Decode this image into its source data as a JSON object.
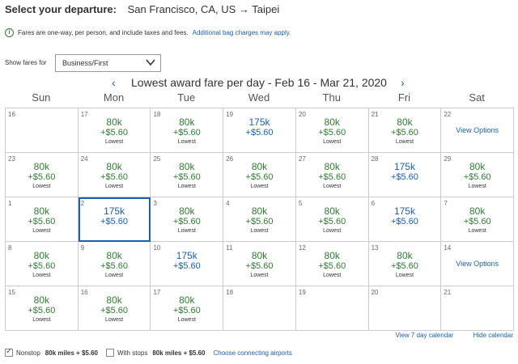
{
  "header": {
    "label": "Select your departure:",
    "route": "San Francisco, CA, US → Taipei"
  },
  "info": {
    "text": "Fares are one-way, per person, and include taxes and fees.",
    "link": "Additional bag charges may apply."
  },
  "filter": {
    "label": "Show fares for",
    "value": "Business/First"
  },
  "calendar": {
    "title": "Lowest award fare per day - Feb 16 - Mar 21, 2020",
    "days": [
      "Sun",
      "Mon",
      "Tue",
      "Wed",
      "Thu",
      "Fri",
      "Sat"
    ],
    "weeks": [
      [
        {
          "num": "16"
        },
        {
          "num": "17",
          "price": "80k",
          "fee": "+$5.60",
          "note": "Lowest",
          "color": "green"
        },
        {
          "num": "18",
          "price": "80k",
          "fee": "+$5.60",
          "note": "Lowest",
          "color": "green"
        },
        {
          "num": "19",
          "price": "175k",
          "fee": "+$5.60",
          "color": "blue"
        },
        {
          "num": "20",
          "price": "80k",
          "fee": "+$5.60",
          "note": "Lowest",
          "color": "green"
        },
        {
          "num": "21",
          "price": "80k",
          "fee": "+$5.60",
          "note": "Lowest",
          "color": "green"
        },
        {
          "num": "22",
          "link": "View Options"
        }
      ],
      [
        {
          "num": "23",
          "price": "80k",
          "fee": "+$5.60",
          "note": "Lowest",
          "color": "green"
        },
        {
          "num": "24",
          "price": "80k",
          "fee": "+$5.60",
          "note": "Lowest",
          "color": "green"
        },
        {
          "num": "25",
          "price": "80k",
          "fee": "+$5.60",
          "note": "Lowest",
          "color": "green"
        },
        {
          "num": "26",
          "price": "80k",
          "fee": "+$5.60",
          "note": "Lowest",
          "color": "green"
        },
        {
          "num": "27",
          "price": "80k",
          "fee": "+$5.60",
          "note": "Lowest",
          "color": "green"
        },
        {
          "num": "28",
          "price": "175k",
          "fee": "+$5.60",
          "color": "blue"
        },
        {
          "num": "29",
          "price": "80k",
          "fee": "+$5.60",
          "note": "Lowest",
          "color": "green"
        }
      ],
      [
        {
          "num": "1",
          "price": "80k",
          "fee": "+$5.60",
          "note": "Lowest",
          "color": "green"
        },
        {
          "num": "2",
          "price": "175k",
          "fee": "+$5.60",
          "color": "blue",
          "selected": true
        },
        {
          "num": "3",
          "price": "80k",
          "fee": "+$5.60",
          "note": "Lowest",
          "color": "green"
        },
        {
          "num": "4",
          "price": "80k",
          "fee": "+$5.60",
          "note": "Lowest",
          "color": "green"
        },
        {
          "num": "5",
          "price": "80k",
          "fee": "+$5.60",
          "note": "Lowest",
          "color": "green"
        },
        {
          "num": "6",
          "price": "175k",
          "fee": "+$5.60",
          "color": "blue"
        },
        {
          "num": "7",
          "price": "80k",
          "fee": "+$5.60",
          "note": "Lowest",
          "color": "green"
        }
      ],
      [
        {
          "num": "8",
          "price": "80k",
          "fee": "+$5.60",
          "note": "Lowest",
          "color": "green"
        },
        {
          "num": "9",
          "price": "80k",
          "fee": "+$5.60",
          "note": "Lowest",
          "color": "green"
        },
        {
          "num": "10",
          "price": "175k",
          "fee": "+$5.60",
          "color": "blue"
        },
        {
          "num": "11",
          "price": "80k",
          "fee": "+$5.60",
          "note": "Lowest",
          "color": "green"
        },
        {
          "num": "12",
          "price": "80k",
          "fee": "+$5.60",
          "note": "Lowest",
          "color": "green"
        },
        {
          "num": "13",
          "price": "80k",
          "fee": "+$5.60",
          "note": "Lowest",
          "color": "green"
        },
        {
          "num": "14",
          "link": "View Options"
        }
      ],
      [
        {
          "num": "15",
          "price": "80k",
          "fee": "+$5.60",
          "note": "Lowest",
          "color": "green"
        },
        {
          "num": "16",
          "price": "80k",
          "fee": "+$5.60",
          "note": "Lowest",
          "color": "green"
        },
        {
          "num": "17",
          "price": "80k",
          "fee": "+$5.60",
          "note": "Lowest",
          "color": "green"
        },
        {
          "num": "18"
        },
        {
          "num": "19"
        },
        {
          "num": "20"
        },
        {
          "num": "21"
        }
      ]
    ]
  },
  "links": {
    "view7": "View 7 day calendar",
    "hide": "Hide calendar"
  },
  "footer": {
    "nonstop_label": "Nonstop",
    "nonstop_checked": true,
    "nonstop_price": "80k miles + $5.60",
    "stops_label": "With stops",
    "stops_checked": false,
    "stops_price": "80k miles + $5.60",
    "connect_link": "Choose connecting airports"
  },
  "colors": {
    "green": "#2e7d32",
    "blue": "#1a5fb4"
  }
}
